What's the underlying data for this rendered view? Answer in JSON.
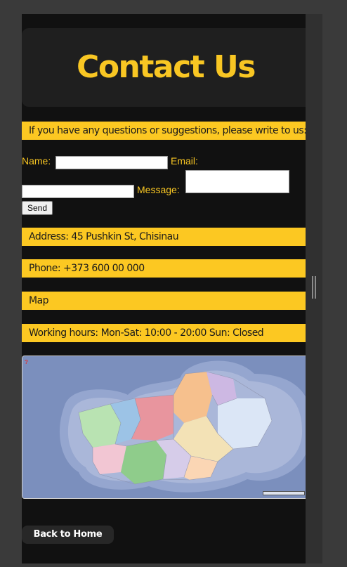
{
  "page": {
    "title": "Contact Us",
    "intro": "If you have any questions or suggestions, please write to us:"
  },
  "form": {
    "name_label": "Name:",
    "name_value": "",
    "email_label": "Email:",
    "email_value": "",
    "message_label": "Message:",
    "message_value": "",
    "send_label": "Send"
  },
  "info": {
    "address": "Address: 45 Pushkin St, Chisinau",
    "phone": "Phone: +373 600 00 000",
    "map_heading": "Map",
    "hours": "Working hours: Mon-Sat: 10:00 - 20:00 Sun: Closed"
  },
  "map": {
    "marker": "?"
  },
  "nav": {
    "back_label": "Back to Home"
  },
  "colors": {
    "accent": "#fcc822",
    "background": "#111111",
    "title": "#f8c623",
    "card": "#1f1f1f"
  }
}
